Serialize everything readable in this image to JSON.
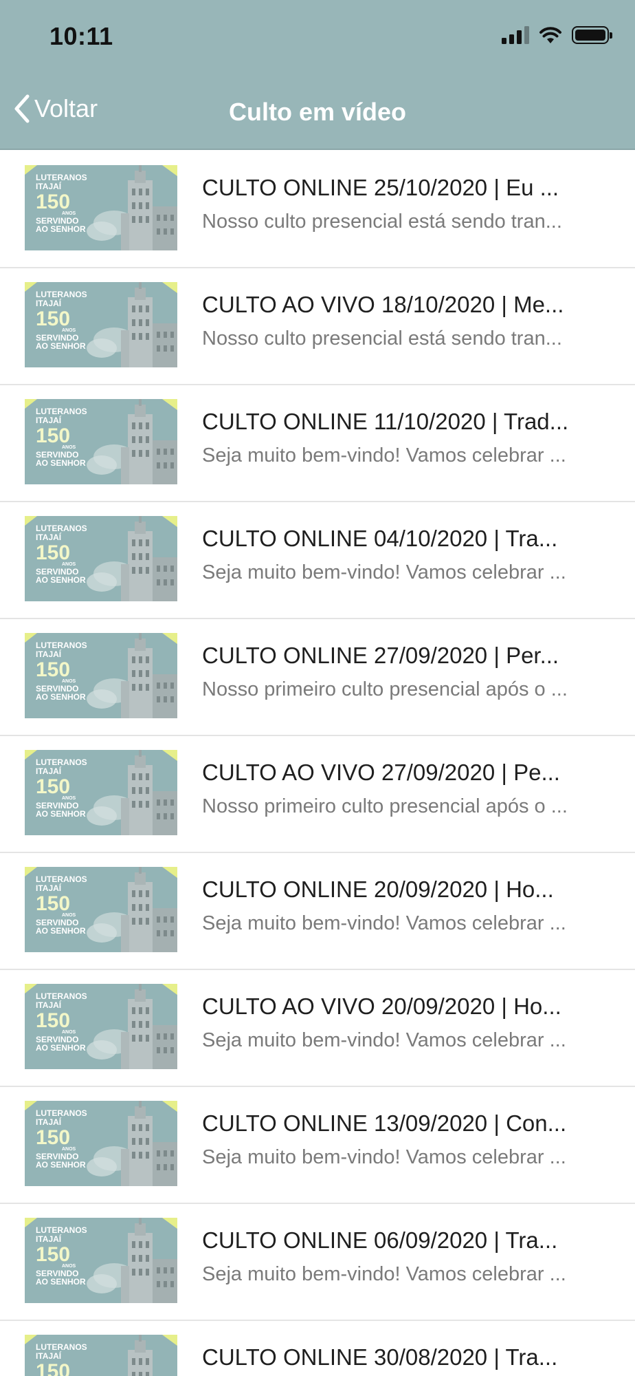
{
  "status_bar": {
    "time": "10:11",
    "icons": [
      "signal-icon",
      "wifi-icon",
      "battery-icon"
    ]
  },
  "nav": {
    "back_label": "Voltar",
    "title": "Culto em vídeo",
    "back_icon": "chevron-left-icon"
  },
  "colors": {
    "header_bg": "#98b6b8",
    "title_text": "#ffffff",
    "subtitle_text": "#7a7a7a"
  },
  "thumbnail": {
    "line1": "LUTERANOS",
    "line2": "ITAJAÍ",
    "number": "150",
    "anos": "ANOS",
    "line3": "SERVINDO",
    "line4": "AO SENHOR"
  },
  "videos": [
    {
      "title": "CULTO ONLINE 25/10/2020 | Eu ...",
      "subtitle": "Nosso culto presencial está sendo tran..."
    },
    {
      "title": "CULTO AO VIVO 18/10/2020 | Me...",
      "subtitle": "Nosso culto presencial está sendo tran..."
    },
    {
      "title": "CULTO ONLINE 11/10/2020 | Trad...",
      "subtitle": "Seja muito bem-vindo! Vamos celebrar ..."
    },
    {
      "title": "CULTO ONLINE 04/10/2020 | Tra...",
      "subtitle": "Seja muito bem-vindo! Vamos celebrar ..."
    },
    {
      "title": "CULTO ONLINE 27/09/2020 | Per...",
      "subtitle": "Nosso primeiro culto presencial após o ..."
    },
    {
      "title": "CULTO AO VIVO 27/09/2020 | Pe...",
      "subtitle": "Nosso primeiro culto presencial após o ..."
    },
    {
      "title": "CULTO ONLINE 20/09/2020 | Ho...",
      "subtitle": "Seja muito bem-vindo! Vamos celebrar ..."
    },
    {
      "title": "CULTO AO VIVO 20/09/2020 | Ho...",
      "subtitle": "Seja muito bem-vindo! Vamos celebrar ..."
    },
    {
      "title": "CULTO ONLINE 13/09/2020 | Con...",
      "subtitle": "Seja muito bem-vindo! Vamos celebrar ..."
    },
    {
      "title": "CULTO ONLINE 06/09/2020 | Tra...",
      "subtitle": "Seja muito bem-vindo! Vamos celebrar ..."
    },
    {
      "title": "CULTO ONLINE 30/08/2020 | Tra...",
      "subtitle": ""
    }
  ]
}
